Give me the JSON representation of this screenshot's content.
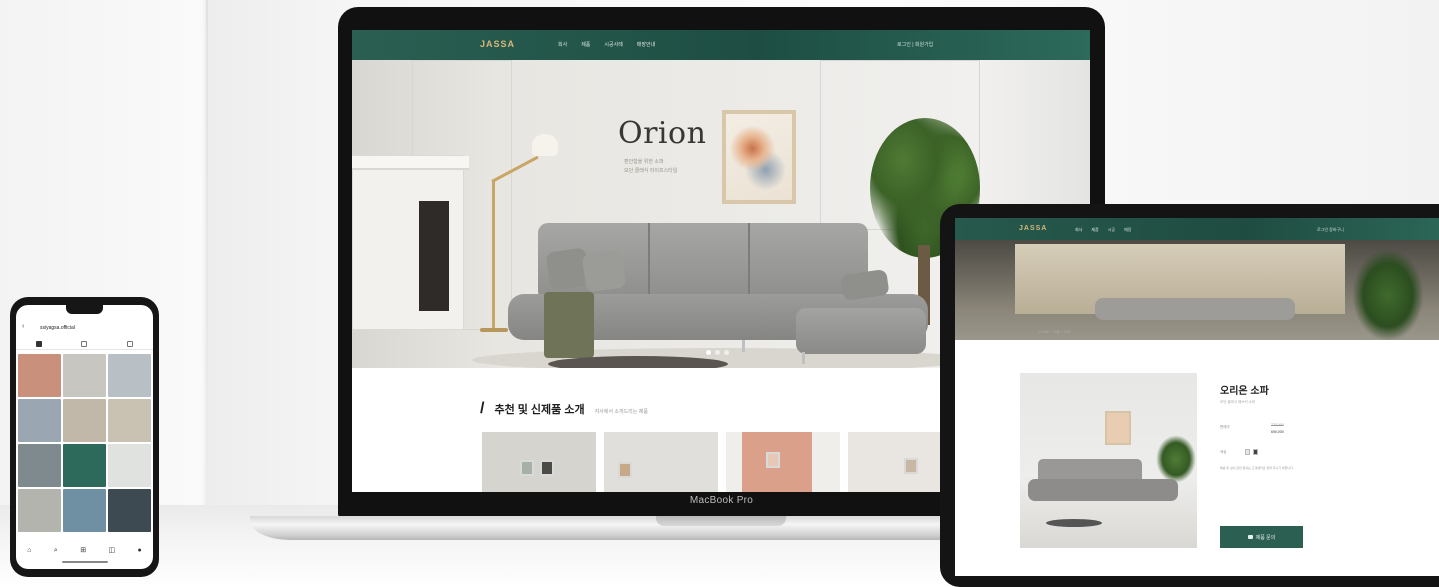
{
  "laptop": {
    "device_label": "MacBook Pro",
    "site": {
      "logo": "JASSA",
      "nav_items": [
        {
          "label": "회사"
        },
        {
          "label": "제품"
        },
        {
          "label": "시공사례"
        },
        {
          "label": "매장안내"
        }
      ],
      "nav_right": "로그인 | 회원가입",
      "hero": {
        "title": "Orion",
        "subtitle_line1": "편안함을 위한 소파",
        "subtitle_line2": "모던 클래식 라이프스타일"
      },
      "section": {
        "title": "추천 및 신제품 소개",
        "subtitle": "쟈사에서 소개드리는 제품"
      },
      "product_cards": [
        {
          "name": "card-1",
          "bg": "#d6d4cf"
        },
        {
          "name": "card-2",
          "bg": "#e1dfdb"
        },
        {
          "name": "card-3",
          "bg": "#dba08a"
        },
        {
          "name": "card-4",
          "bg": "#e9e6e1"
        }
      ]
    }
  },
  "tablet": {
    "site": {
      "logo": "JASSA",
      "nav_items": [
        {
          "label": "회사"
        },
        {
          "label": "제품"
        },
        {
          "label": "시공"
        },
        {
          "label": "매장"
        }
      ],
      "nav_right": "로그인  장바구니",
      "breadcrumb": "HOME > 제품 > 소파",
      "product": {
        "title": "오리온 소파",
        "description": "모던 클래식 패브릭 소파",
        "price_label": "판매가",
        "original_price": "770,000",
        "sale_price": "690,000",
        "option_label": "색상",
        "note": "배송 및 설치 관련 문의는 고객센터로 연락 주시기 바랍니다.",
        "cart_button": "제품 문의"
      }
    }
  },
  "phone": {
    "account": "ssiyagsa.official",
    "grid_tiles": [
      "#c9917b",
      "#c7c6c1",
      "#b8c0c6",
      "#9aa7b3",
      "#c2b8a9",
      "#c9c2b2",
      "#7f8a8e",
      "#2e6a5c",
      "#e0e2e0",
      "#b4b4ae",
      "#6f8fa3",
      "#3e4a52"
    ]
  },
  "colors": {
    "brand_green": "#2a5f52",
    "logo_gold": "#d8b87a"
  }
}
